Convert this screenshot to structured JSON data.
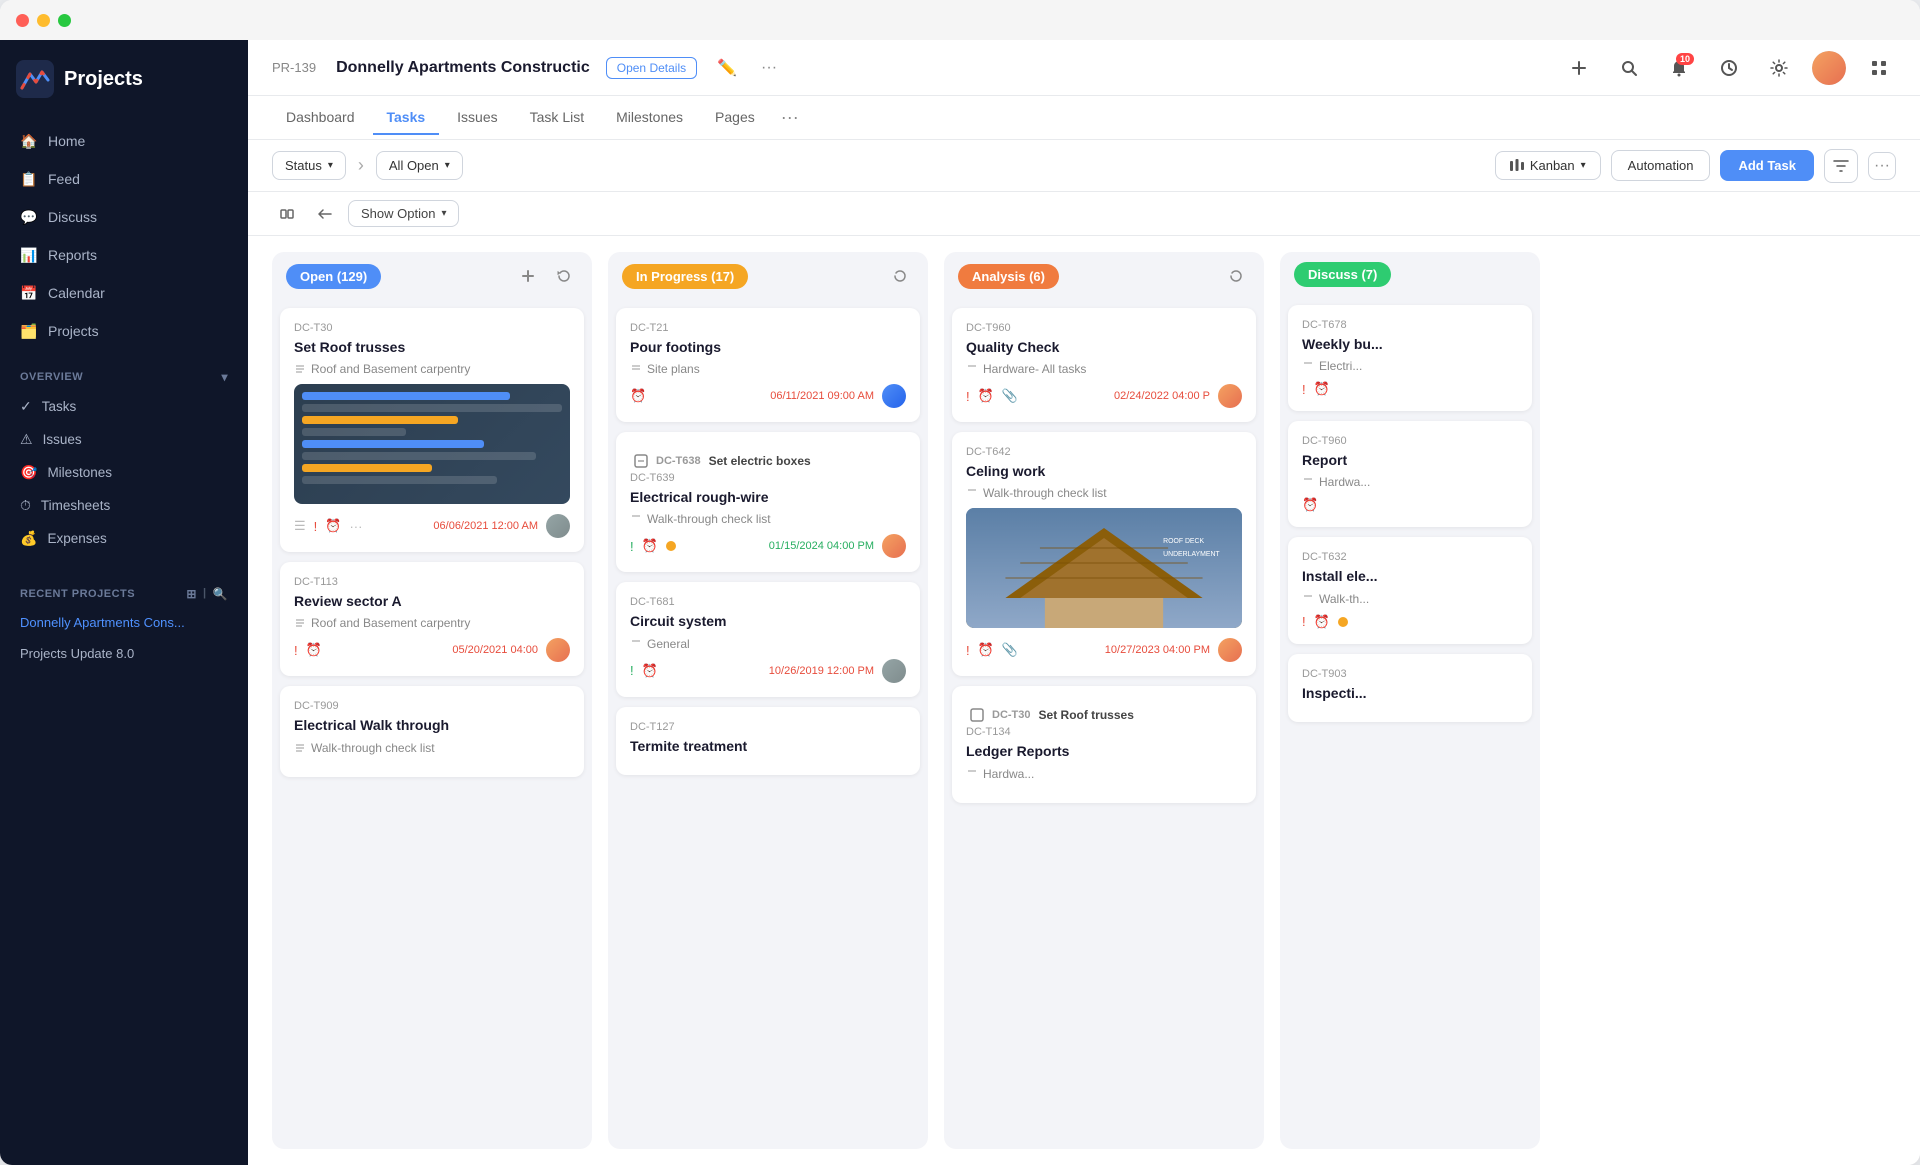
{
  "window": {
    "title": "Projects",
    "titlebar_buttons": [
      "red",
      "yellow",
      "green"
    ]
  },
  "sidebar": {
    "logo": "Projects",
    "nav_items": [
      {
        "id": "home",
        "label": "Home",
        "icon": "home"
      },
      {
        "id": "feed",
        "label": "Feed",
        "icon": "feed"
      },
      {
        "id": "discuss",
        "label": "Discuss",
        "icon": "discuss"
      },
      {
        "id": "reports",
        "label": "Reports",
        "icon": "reports"
      },
      {
        "id": "calendar",
        "label": "Calendar",
        "icon": "calendar"
      },
      {
        "id": "projects",
        "label": "Projects",
        "icon": "projects"
      }
    ],
    "overview_section": "Overview",
    "overview_items": [
      {
        "label": "Tasks"
      },
      {
        "label": "Issues"
      },
      {
        "label": "Milestones"
      },
      {
        "label": "Timesheets"
      },
      {
        "label": "Expenses"
      }
    ],
    "recent_section": "Recent Projects",
    "recent_items": [
      {
        "label": "Donnelly Apartments Cons...",
        "active": true
      },
      {
        "label": "Projects Update 8.0",
        "active": false
      }
    ]
  },
  "topbar": {
    "project_id": "PR-139",
    "project_title": "Donnelly Apartments Constructic",
    "open_details_label": "Open Details",
    "tabs": [
      {
        "label": "Dashboard",
        "active": false
      },
      {
        "label": "Tasks",
        "active": true
      },
      {
        "label": "Issues",
        "active": false
      },
      {
        "label": "Task List",
        "active": false
      },
      {
        "label": "Milestones",
        "active": false
      },
      {
        "label": "Pages",
        "active": false
      }
    ],
    "notification_count": "10"
  },
  "toolbar": {
    "status_label": "Status",
    "all_open_label": "All Open",
    "kanban_label": "Kanban",
    "automation_label": "Automation",
    "add_task_label": "Add Task",
    "show_option_label": "Show Option"
  },
  "columns": [
    {
      "id": "open",
      "label": "Open (129)",
      "badge_color": "#4f8ef7",
      "tasks": [
        {
          "id": "DC-T30",
          "title": "Set Roof trusses",
          "subtitle": "Roof and Basement carpentry",
          "has_thumb": true,
          "footer_icons": [
            "list",
            "exclaim",
            "clock",
            "more"
          ],
          "date": "06/06/2021 12:00 AM",
          "date_color": "red",
          "has_avatar": true
        },
        {
          "id": "DC-T113",
          "title": "Review sector A",
          "subtitle": "Roof and Basement carpentry",
          "has_thumb": false,
          "footer_icons": [
            "exclaim",
            "clock"
          ],
          "date": "05/20/2021 04:00",
          "date_color": "red",
          "has_avatar": true
        },
        {
          "id": "DC-T909",
          "title": "Electrical Walk through",
          "subtitle": "Walk-through check list",
          "has_thumb": false,
          "footer_icons": [],
          "date": "",
          "date_color": "red",
          "has_avatar": false
        }
      ]
    },
    {
      "id": "inprogress",
      "label": "In Progress (17)",
      "badge_color": "#f5a623",
      "tasks": [
        {
          "id": "DC-T21",
          "title": "Pour footings",
          "subtitle": "Site plans",
          "has_thumb": false,
          "footer_icons": [
            "clock"
          ],
          "date": "06/11/2021 09:00 AM",
          "date_color": "red",
          "has_avatar": true
        },
        {
          "group_id": "DC-T638",
          "group_title": "Set electric boxes",
          "id": "DC-T639",
          "title": "Electrical rough-wire",
          "subtitle": "Walk-through check list",
          "has_thumb": false,
          "footer_icons": [
            "exclaim",
            "clock",
            "dot_yellow"
          ],
          "date": "01/15/2024 04:00 PM",
          "date_color": "green",
          "has_avatar": true
        },
        {
          "id": "DC-T681",
          "title": "Circuit system",
          "subtitle": "General",
          "has_thumb": false,
          "footer_icons": [
            "exclaim",
            "clock"
          ],
          "date": "10/26/2019 12:00 PM",
          "date_color": "red",
          "has_avatar": true
        },
        {
          "id": "DC-T127",
          "title": "Termite treatment",
          "subtitle": "",
          "has_thumb": false,
          "footer_icons": [],
          "date": "",
          "date_color": "",
          "has_avatar": false
        }
      ]
    },
    {
      "id": "analysis",
      "label": "Analysis (6)",
      "badge_color": "#f07b3f",
      "tasks": [
        {
          "id": "DC-T960",
          "title": "Quality Check",
          "subtitle": "Hardware- All tasks",
          "has_thumb": false,
          "footer_icons": [
            "exclaim",
            "clock",
            "clip"
          ],
          "date": "02/24/2022 04:00 P",
          "date_color": "red",
          "has_avatar": true
        },
        {
          "id": "DC-T642",
          "title": "Celing work",
          "subtitle": "Walk-through check list",
          "has_roof": true,
          "footer_icons": [
            "exclaim",
            "clock",
            "clip"
          ],
          "date": "10/27/2023 04:00 PM",
          "date_color": "red",
          "has_avatar": true
        },
        {
          "group_id": "DC-T30",
          "group_title": "Set Roof trusses",
          "id": "DC-T134",
          "title": "Ledger Reports",
          "subtitle": "Hardwa...",
          "has_thumb": false,
          "footer_icons": [],
          "date": "",
          "date_color": "",
          "has_avatar": false
        }
      ]
    },
    {
      "id": "discuss",
      "label": "Discuss (7)",
      "badge_color": "#2ecc71",
      "tasks": [
        {
          "id": "DC-T678",
          "title": "Weekly bu...",
          "subtitle": "Electri...",
          "has_thumb": false,
          "footer_icons": [
            "exclaim",
            "clock"
          ],
          "date": "",
          "date_color": "",
          "has_avatar": false
        },
        {
          "id": "DC-T960",
          "title": "Report",
          "subtitle": "Hardwa...",
          "has_thumb": false,
          "footer_icons": [
            "clock"
          ],
          "date": "",
          "date_color": "",
          "has_avatar": false
        },
        {
          "id": "DC-T632",
          "title": "Install ele...",
          "subtitle": "Walk-th...",
          "has_thumb": false,
          "footer_icons": [
            "exclaim",
            "clock",
            "dot_yellow"
          ],
          "date": "",
          "date_color": "",
          "has_avatar": false
        },
        {
          "id": "DC-T903",
          "title": "Inspecti...",
          "subtitle": "",
          "has_thumb": false,
          "footer_icons": [],
          "date": "",
          "date_color": "",
          "has_avatar": false
        }
      ]
    }
  ]
}
